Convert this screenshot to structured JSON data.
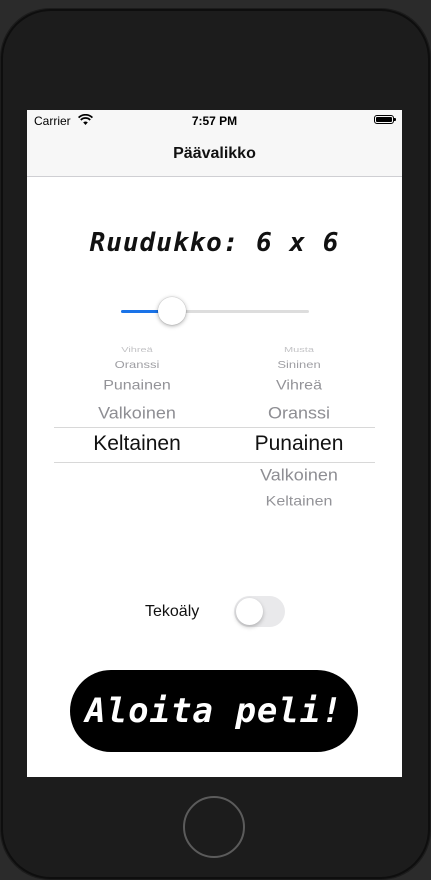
{
  "status_bar": {
    "carrier": "Carrier",
    "time": "7:57 PM"
  },
  "nav": {
    "title": "Päävalikko"
  },
  "grid": {
    "label": "Ruudukko: 6 x 6",
    "slider_fraction": 0.27
  },
  "pickers": {
    "left": {
      "items": [
        "Vihreä",
        "Oranssi",
        "Punainen",
        "Valkoinen",
        "Keltainen"
      ],
      "selected": "Keltainen"
    },
    "right": {
      "items": [
        "Musta",
        "Sininen",
        "Vihreä",
        "Oranssi",
        "Punainen",
        "Valkoinen",
        "Keltainen"
      ],
      "selected": "Punainen"
    }
  },
  "ai_toggle": {
    "label": "Tekoäly",
    "on": false
  },
  "start_button": {
    "label": "Aloita peli!"
  },
  "colors": {
    "accent": "#1a73e8",
    "button_bg": "#000000"
  }
}
